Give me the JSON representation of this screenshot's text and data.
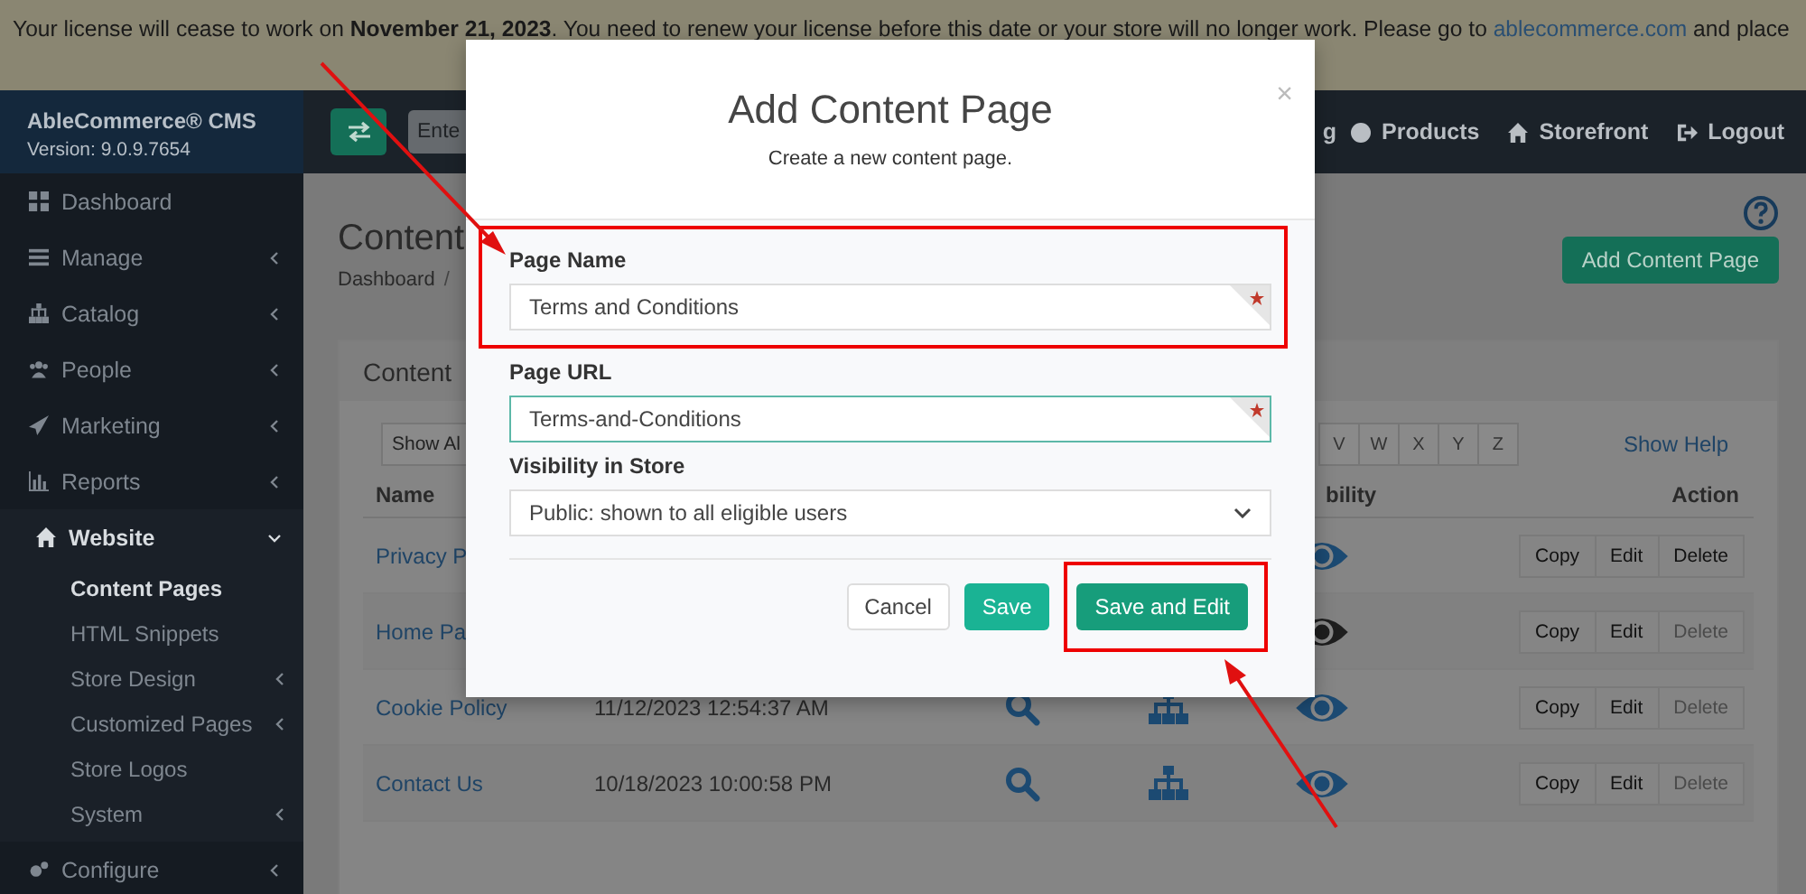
{
  "notice": {
    "text": "Your license will cease to work on **November 21, 2023**. You need to renew your license before this date or your store will no longer work. Please go to",
    "link": "ablecommerce.com",
    "text_after": "and place"
  },
  "brand": {
    "name": "AbleCommerce® CMS",
    "version": "Version: 9.0.9.7654"
  },
  "sidebar": {
    "items": [
      {
        "label": "Dashboard",
        "kind": "link",
        "expanded": false
      },
      {
        "label": "Manage",
        "kind": "menu",
        "expanded": false
      },
      {
        "label": "Catalog",
        "kind": "menu",
        "expanded": false
      },
      {
        "label": "People",
        "kind": "menu",
        "expanded": false
      },
      {
        "label": "Marketing",
        "kind": "menu",
        "expanded": false
      },
      {
        "label": "Reports",
        "kind": "menu",
        "expanded": false
      },
      {
        "label": "Website",
        "kind": "menu",
        "expanded": true,
        "children": [
          {
            "label": "Content Pages",
            "kind": "link",
            "selected": true
          },
          {
            "label": "HTML Snippets",
            "kind": "link",
            "selected": false
          },
          {
            "label": "Store Design",
            "kind": "menu",
            "selected": false
          },
          {
            "label": "Customized Pages",
            "kind": "menu",
            "selected": false
          },
          {
            "label": "Store Logos",
            "kind": "link",
            "selected": false
          },
          {
            "label": "System",
            "kind": "menu",
            "selected": false
          }
        ]
      },
      {
        "label": "Configure",
        "kind": "menu",
        "expanded": false
      }
    ]
  },
  "topbar": {
    "search": {
      "placeholder": "Ente"
    },
    "nav": [
      {
        "label": "g"
      },
      {
        "label": "Products"
      },
      {
        "label": "Storefront"
      },
      {
        "label": "Logout"
      }
    ]
  },
  "page": {
    "title": "Content",
    "breadcrumb": [
      {
        "label": "Dashboard",
        "separator": "/"
      }
    ],
    "add_button": "Add Content Page"
  },
  "card": {
    "title": "Content",
    "show_all": "Show Al",
    "letters": [
      "V",
      "W",
      "X",
      "Y",
      "Z"
    ],
    "show_help": "Show Help",
    "columns": [
      {
        "label": "Name"
      },
      {
        "label": "bility"
      },
      {
        "label": "Action"
      }
    ],
    "rows": [
      {
        "name": "Privacy P",
        "visible": true,
        "actions": [
          {
            "label": "Copy",
            "disabled": false
          },
          {
            "label": "Edit",
            "disabled": false
          },
          {
            "label": "Delete",
            "disabled": false
          }
        ]
      },
      {
        "name": "Home Pa",
        "visible": false,
        "actions": [
          {
            "label": "Copy",
            "disabled": false
          },
          {
            "label": "Edit",
            "disabled": false
          },
          {
            "label": "Delete",
            "disabled": true
          }
        ]
      },
      {
        "name": "Cookie Policy",
        "date": "11/12/2023 12:54:37 AM",
        "visible": true,
        "actions": [
          {
            "label": "Copy",
            "disabled": false
          },
          {
            "label": "Edit",
            "disabled": false
          },
          {
            "label": "Delete",
            "disabled": true
          }
        ]
      },
      {
        "name": "Contact Us",
        "date": "10/18/2023 10:00:58 PM",
        "visible": true,
        "actions": [
          {
            "label": "Copy",
            "disabled": false
          },
          {
            "label": "Edit",
            "disabled": false
          },
          {
            "label": "Delete",
            "disabled": true
          }
        ]
      }
    ]
  },
  "modal": {
    "title": "Add Content Page",
    "subtitle": "Create a new content page.",
    "close": "×",
    "fields": [
      {
        "label": "Page Name",
        "kind": "text",
        "value": "Terms and Conditions",
        "required": true,
        "focused": false,
        "highlighted": true
      },
      {
        "label": "Page URL",
        "kind": "text",
        "value": "Terms-and-Conditions",
        "required": true,
        "focused": true,
        "highlighted": false
      },
      {
        "label": "Visibility in Store",
        "kind": "select",
        "value": "Public: shown to all eligible users",
        "required": false,
        "focused": false,
        "highlighted": false
      }
    ],
    "buttons": [
      {
        "label": "Cancel",
        "kind": "default",
        "highlighted": false
      },
      {
        "label": "Save",
        "kind": "success",
        "highlighted": false
      },
      {
        "label": "Save and Edit",
        "kind": "primary",
        "highlighted": true
      }
    ]
  }
}
